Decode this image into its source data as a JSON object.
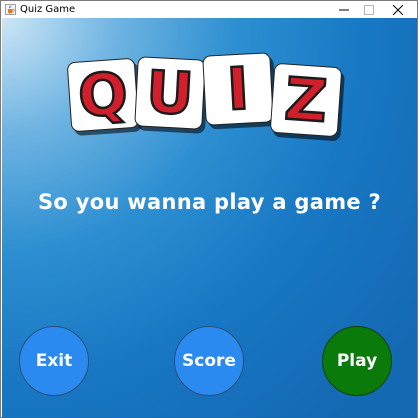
{
  "window": {
    "title": "Quiz Game",
    "icon": "java-cup-icon",
    "controls": {
      "minimize": "minimize-icon",
      "maximize": "maximize-icon",
      "close": "close-icon"
    }
  },
  "logo": {
    "letters": [
      "Q",
      "U",
      "I",
      "Z"
    ],
    "letter_color": "#d11f2c",
    "tile_color": "#ffffff"
  },
  "tagline": "So you wanna play a game ?",
  "buttons": {
    "exit": "Exit",
    "score": "Score",
    "play": "Play"
  },
  "colors": {
    "background_primary": "#1877c3",
    "button_blue": "#2b8af0",
    "button_green": "#0a7a0a"
  }
}
